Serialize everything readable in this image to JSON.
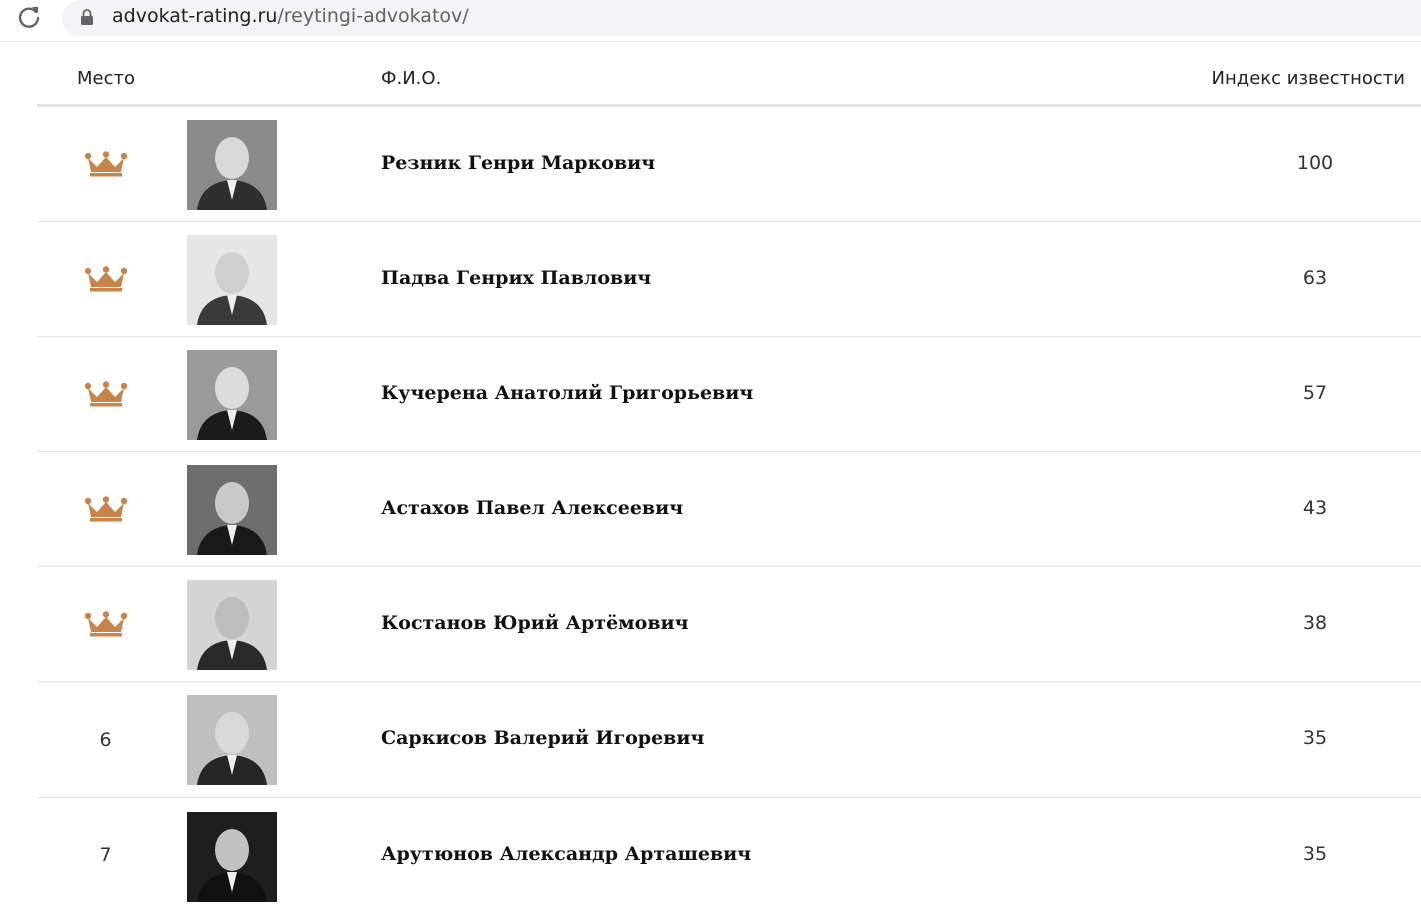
{
  "browser": {
    "url_host": "advokat-rating.ru",
    "url_path": "/reytingi-advokatov/"
  },
  "table": {
    "headers": {
      "place": "Место",
      "name": "Ф.И.О.",
      "index": "Индекс известности"
    },
    "rows": [
      {
        "place": "",
        "crown": true,
        "name": "Резник Генри Маркович",
        "index": "100",
        "photo": "portrait-photo"
      },
      {
        "place": "",
        "crown": true,
        "name": "Падва Генрих Павлович",
        "index": "63",
        "photo": "portrait-photo"
      },
      {
        "place": "",
        "crown": true,
        "name": "Кучерена Анатолий Григорьевич",
        "index": "57",
        "photo": "portrait-photo"
      },
      {
        "place": "",
        "crown": true,
        "name": "Астахов Павел Алексеевич",
        "index": "43",
        "photo": "portrait-photo"
      },
      {
        "place": "",
        "crown": true,
        "name": "Костанов Юрий Артёмович",
        "index": "38",
        "photo": "portrait-photo"
      },
      {
        "place": "6",
        "crown": false,
        "name": "Саркисов Валерий Игоревич",
        "index": "35",
        "photo": "portrait-photo"
      },
      {
        "place": "7",
        "crown": false,
        "name": "Арутюнов Александр Арташевич",
        "index": "35",
        "photo": "portrait-photo"
      }
    ]
  },
  "colors": {
    "crown": "#c8844d",
    "divider": "#e3e3e3",
    "omnibox": "#f1f3f4"
  },
  "icons": [
    "reload-icon",
    "lock-icon",
    "crown-icon"
  ]
}
